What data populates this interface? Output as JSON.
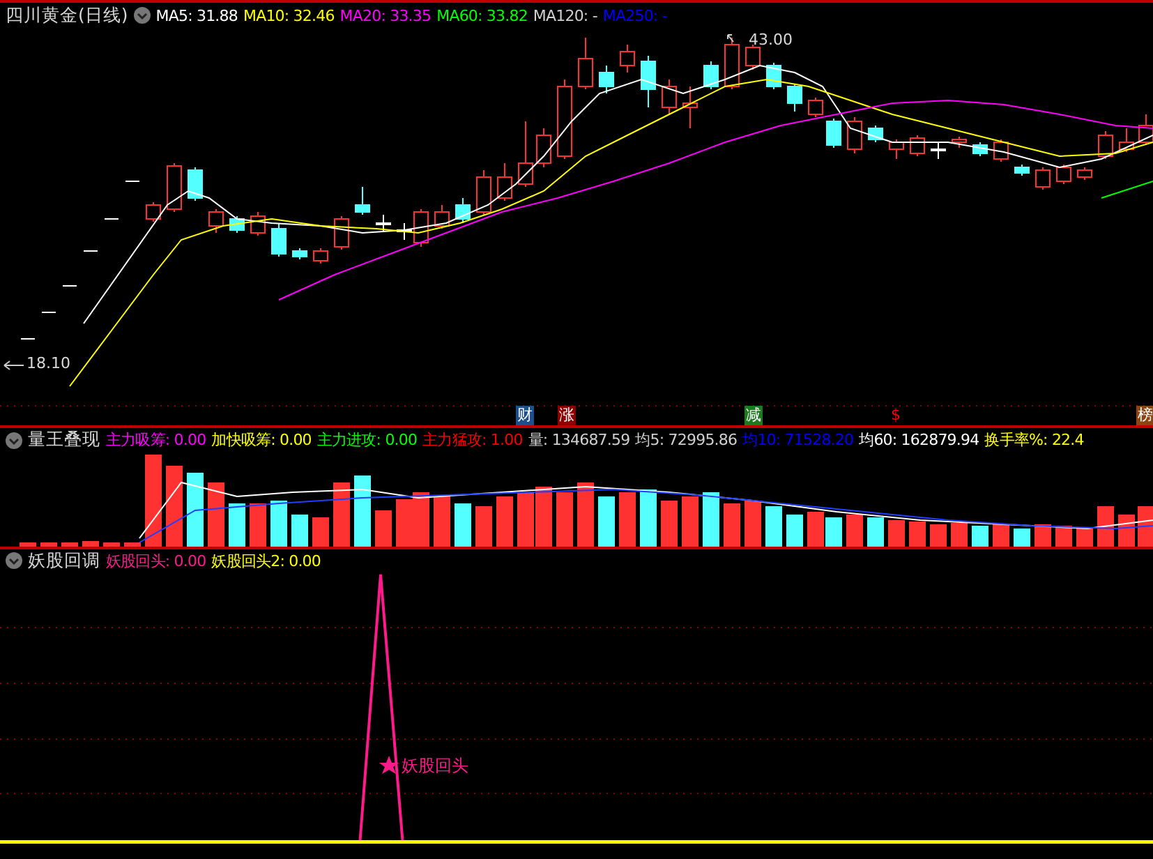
{
  "main_chart": {
    "title": "四川黄金(日线)",
    "indicators": [
      {
        "label": "MA5: 31.88",
        "color": "#ffffff"
      },
      {
        "label": "MA10: 32.46",
        "color": "#ffff00"
      },
      {
        "label": "MA20: 33.35",
        "color": "#ff00ff"
      },
      {
        "label": "MA60: 33.82",
        "color": "#00ff00"
      },
      {
        "label": "MA120: -",
        "color": "#d0d0d0"
      },
      {
        "label": "MA250: -",
        "color": "#0000ff"
      }
    ],
    "high_label": "43.00",
    "low_label": "18.10",
    "signals": [
      {
        "text": "财",
        "kind": "badge",
        "color": "#1c4f8c"
      },
      {
        "text": "涨",
        "kind": "badge",
        "color": "#8b0000"
      },
      {
        "text": "减",
        "kind": "badge",
        "color": "#1e7a1e"
      },
      {
        "text": "$",
        "kind": "plain",
        "color": "#ff0000"
      },
      {
        "text": "榜",
        "kind": "badge",
        "color": "#8b4513"
      }
    ]
  },
  "volume_panel": {
    "title": "量王叠现",
    "indicators": [
      {
        "label": "主力吸筹: 0.00",
        "color": "#ff00ff"
      },
      {
        "label": "加快吸筹: 0.00",
        "color": "#ffff00"
      },
      {
        "label": "主力进攻: 0.00",
        "color": "#00ff00"
      },
      {
        "label": "主力猛攻: 1.00",
        "color": "#ff0000"
      },
      {
        "label": "量: 134687.59",
        "color": "#d0d0d0"
      },
      {
        "label": "均5: 72995.86",
        "color": "#d0d0d0"
      },
      {
        "label": "均10: 71528.20",
        "color": "#0000ff"
      },
      {
        "label": "均60: 162879.94",
        "color": "#ffffff"
      },
      {
        "label": "换手率%: 22.4",
        "color": "#ffff00"
      }
    ]
  },
  "demon_panel": {
    "title": "妖股回调",
    "indicators": [
      {
        "label": "妖股回头: 0.00",
        "color": "#ff1a8c"
      },
      {
        "label": "妖股回头2: 0.00",
        "color": "#ffff00"
      }
    ],
    "spike_label": "妖股回头"
  }
}
